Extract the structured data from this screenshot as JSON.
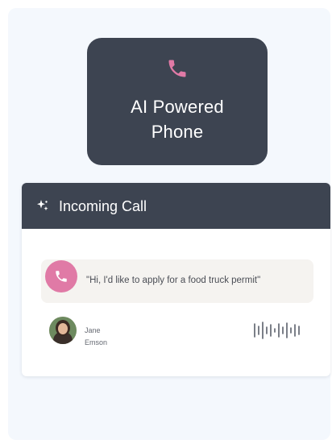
{
  "phone_card": {
    "icon": "phone-icon",
    "title": "AI Powered\nPhone"
  },
  "call_card": {
    "header_icon": "sparkle-icon",
    "header_label": "Incoming Call",
    "transcript_icon": "phone-icon",
    "transcript": "\"Hi, I'd like to apply for a food truck permit\"",
    "caller": {
      "first_name": "Jane",
      "last_name": "Emson"
    },
    "waveform_icon": "audio-waveform-icon"
  },
  "colors": {
    "dark_card": "#3d4451",
    "accent_pink": "#e07aa6",
    "panel_bg": "#f4f8fd",
    "bubble_bg": "#f5f3f0"
  }
}
